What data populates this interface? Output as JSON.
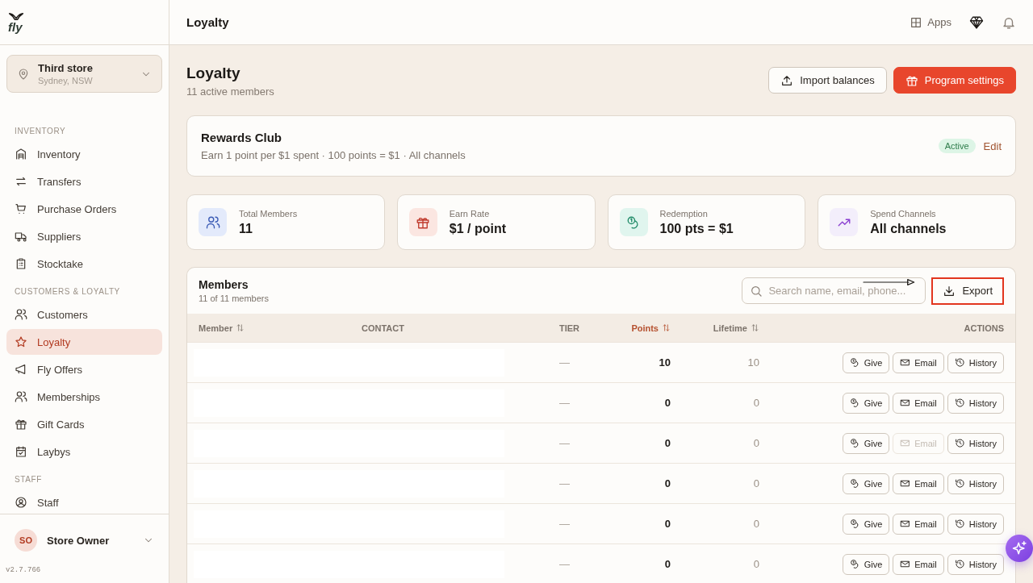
{
  "sidebar": {
    "logo": "fly",
    "store": {
      "name": "Third store",
      "location": "Sydney, NSW"
    },
    "sections": [
      {
        "heading": "INVENTORY",
        "items": [
          {
            "label": "Inventory",
            "selected": false
          },
          {
            "label": "Transfers",
            "selected": false
          },
          {
            "label": "Purchase Orders",
            "selected": false
          },
          {
            "label": "Suppliers",
            "selected": false
          },
          {
            "label": "Stocktake",
            "selected": false
          }
        ]
      },
      {
        "heading": "CUSTOMERS & LOYALTY",
        "items": [
          {
            "label": "Customers",
            "selected": false
          },
          {
            "label": "Loyalty",
            "selected": true
          },
          {
            "label": "Fly Offers",
            "selected": false
          },
          {
            "label": "Memberships",
            "selected": false
          },
          {
            "label": "Gift Cards",
            "selected": false
          },
          {
            "label": "Laybys",
            "selected": false
          }
        ]
      },
      {
        "heading": "STAFF",
        "items": [
          {
            "label": "Staff",
            "selected": false
          }
        ]
      }
    ],
    "user": {
      "initials": "SO",
      "name": "Store Owner"
    },
    "version": "v2.7.766"
  },
  "topbar": {
    "title": "Loyalty",
    "apps": "Apps"
  },
  "page": {
    "title": "Loyalty",
    "subtitle": "11 active members",
    "buttons": [
      {
        "label": "Import balances",
        "kind": "secondary"
      },
      {
        "label": "Program settings",
        "kind": "primary"
      }
    ]
  },
  "program": {
    "name": "Rewards Club",
    "description": "Earn 1 point per $1 spent · 100 points = $1 · All channels",
    "status": "Active",
    "edit": "Edit"
  },
  "stats": [
    {
      "label": "Total Members",
      "value": "11",
      "color": "#e3eafb"
    },
    {
      "label": "Earn Rate",
      "value": "$1 / point",
      "color": "#fbe6e1"
    },
    {
      "label": "Redemption",
      "value": "100 pts = $1",
      "color": "#e0f5ee"
    },
    {
      "label": "Spend Channels",
      "value": "All channels",
      "color": "#f3eefb"
    }
  ],
  "members": {
    "title": "Members",
    "count": "11 of 11 members",
    "search": {
      "placeholder": "Search name, email, phone..."
    },
    "export": {
      "label": "Export",
      "highlighted": true
    },
    "columns": [
      {
        "label": "Member",
        "sortable": true,
        "sorted": false
      },
      {
        "label": "CONTACT",
        "sortable": false,
        "sorted": false
      },
      {
        "label": "TIER",
        "sortable": false,
        "sorted": false
      },
      {
        "label": "Points",
        "sortable": true,
        "sorted": true
      },
      {
        "label": "Lifetime",
        "sortable": true,
        "sorted": false
      },
      {
        "label": "ACTIONS",
        "sortable": false,
        "sorted": false
      }
    ],
    "rows": [
      {
        "tier": "—",
        "points": "10",
        "lifetime": "10",
        "actions": [
          {
            "kind": "give",
            "label": "Give",
            "disabled": false
          },
          {
            "kind": "email",
            "label": "Email",
            "disabled": false
          },
          {
            "kind": "history",
            "label": "History",
            "disabled": false
          }
        ]
      },
      {
        "tier": "—",
        "points": "0",
        "lifetime": "0",
        "actions": [
          {
            "kind": "give",
            "label": "Give",
            "disabled": false
          },
          {
            "kind": "email",
            "label": "Email",
            "disabled": false
          },
          {
            "kind": "history",
            "label": "History",
            "disabled": false
          }
        ]
      },
      {
        "tier": "—",
        "points": "0",
        "lifetime": "0",
        "actions": [
          {
            "kind": "give",
            "label": "Give",
            "disabled": false
          },
          {
            "kind": "email",
            "label": "Email",
            "disabled": true
          },
          {
            "kind": "history",
            "label": "History",
            "disabled": false
          }
        ]
      },
      {
        "tier": "—",
        "points": "0",
        "lifetime": "0",
        "actions": [
          {
            "kind": "give",
            "label": "Give",
            "disabled": false
          },
          {
            "kind": "email",
            "label": "Email",
            "disabled": false
          },
          {
            "kind": "history",
            "label": "History",
            "disabled": false
          }
        ]
      },
      {
        "tier": "—",
        "points": "0",
        "lifetime": "0",
        "actions": [
          {
            "kind": "give",
            "label": "Give",
            "disabled": false
          },
          {
            "kind": "email",
            "label": "Email",
            "disabled": false
          },
          {
            "kind": "history",
            "label": "History",
            "disabled": false
          }
        ]
      },
      {
        "tier": "—",
        "points": "0",
        "lifetime": "0",
        "actions": [
          {
            "kind": "give",
            "label": "Give",
            "disabled": false
          },
          {
            "kind": "email",
            "label": "Email",
            "disabled": false
          },
          {
            "kind": "history",
            "label": "History",
            "disabled": false
          }
        ]
      }
    ]
  }
}
